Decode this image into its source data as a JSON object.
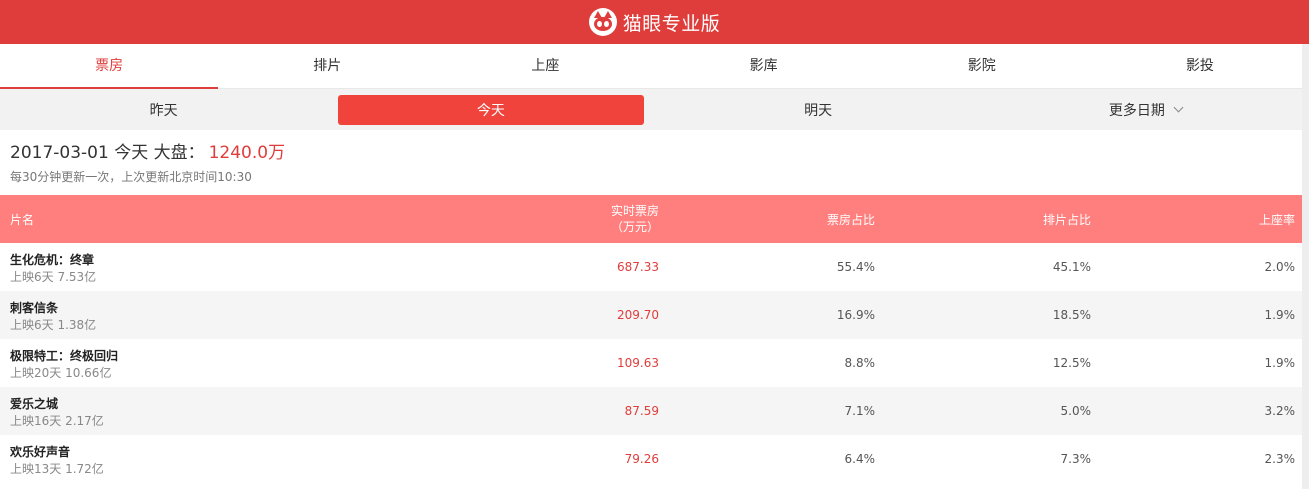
{
  "brand": {
    "title": "猫眼专业版",
    "logo_icon": "cat-eye-logo-icon"
  },
  "colors": {
    "accent": "#df3d3b",
    "header_row": "#ff7f7f"
  },
  "nav_tabs": [
    {
      "label": "票房",
      "active": true
    },
    {
      "label": "排片"
    },
    {
      "label": "上座"
    },
    {
      "label": "影库"
    },
    {
      "label": "影院"
    },
    {
      "label": "影投"
    }
  ],
  "date_tabs": [
    {
      "label": "昨天"
    },
    {
      "label": "今天",
      "active": true
    },
    {
      "label": "明天"
    },
    {
      "label": "更多日期"
    }
  ],
  "summary": {
    "prefix": "2017-03-01 今天 大盘：",
    "amount": "1240.0万"
  },
  "updated": "每30分钟更新一次，上次更新北京时间10:30",
  "table": {
    "headers": {
      "name": "片名",
      "box_line1": "实时票房",
      "box_line2": "（万元）",
      "box_share": "票房占比",
      "show_share": "排片占比",
      "seat_rate": "上座率"
    },
    "rows": [
      {
        "title": "生化危机：终章",
        "sub": "上映6天 7.53亿",
        "box": "687.33",
        "box_share": "55.4%",
        "show_share": "45.1%",
        "seat_rate": "2.0%"
      },
      {
        "title": "刺客信条",
        "sub": "上映6天 1.38亿",
        "box": "209.70",
        "box_share": "16.9%",
        "show_share": "18.5%",
        "seat_rate": "1.9%"
      },
      {
        "title": "极限特工：终极回归",
        "sub": "上映20天 10.66亿",
        "box": "109.63",
        "box_share": "8.8%",
        "show_share": "12.5%",
        "seat_rate": "1.9%"
      },
      {
        "title": "爱乐之城",
        "sub": "上映16天 2.17亿",
        "box": "87.59",
        "box_share": "7.1%",
        "show_share": "5.0%",
        "seat_rate": "3.2%"
      },
      {
        "title": "欢乐好声音",
        "sub": "上映13天 1.72亿",
        "box": "79.26",
        "box_share": "6.4%",
        "show_share": "7.3%",
        "seat_rate": "2.3%"
      }
    ]
  }
}
